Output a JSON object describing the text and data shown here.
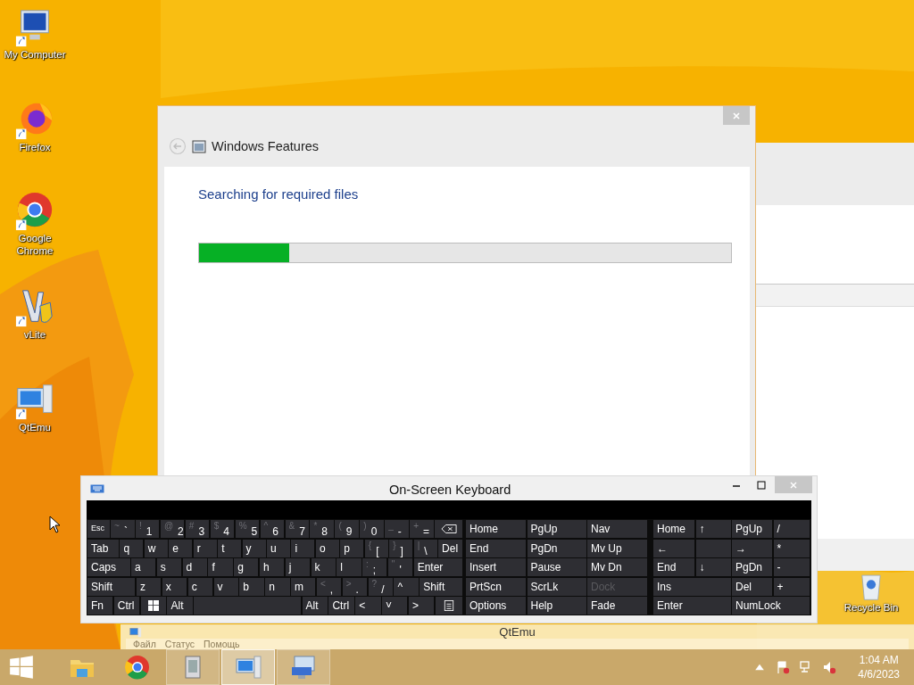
{
  "desktop_icons": [
    {
      "label": "My Computer",
      "kind": "computer"
    },
    {
      "label": "Firefox",
      "kind": "firefox"
    },
    {
      "label": "Google Chrome",
      "kind": "chrome"
    },
    {
      "label": "vLite",
      "kind": "vlite"
    },
    {
      "label": "QtEmu",
      "kind": "qtemu"
    }
  ],
  "recycle_bin": {
    "label": "Recycle Bin"
  },
  "features_window": {
    "title": "Windows Features",
    "status": "Searching for required files",
    "progress": {
      "level": 0.17
    }
  },
  "qtemu_window": {
    "title": "QtEmu",
    "menu": [
      "Файл",
      "Статус",
      "Помощь"
    ]
  },
  "keyboard": {
    "title": "On-Screen Keyboard",
    "main_rows": [
      [
        {
          "label": "Esc",
          "kind": "small"
        },
        {
          "label": "`",
          "shift": "~"
        },
        {
          "label": "1",
          "shift": "!"
        },
        {
          "label": "2",
          "shift": "@"
        },
        {
          "label": "3",
          "shift": "#"
        },
        {
          "label": "4",
          "shift": "$"
        },
        {
          "label": "5",
          "shift": "%"
        },
        {
          "label": "6",
          "shift": "^"
        },
        {
          "label": "7",
          "shift": "&"
        },
        {
          "label": "8",
          "shift": "*"
        },
        {
          "label": "9",
          "shift": "("
        },
        {
          "label": "0",
          "shift": ")"
        },
        {
          "label": "-",
          "shift": "_"
        },
        {
          "label": "=",
          "shift": "+"
        },
        {
          "kind": "backspace"
        }
      ],
      [
        {
          "label": "Tab"
        },
        {
          "label": "q"
        },
        {
          "label": "w"
        },
        {
          "label": "e"
        },
        {
          "label": "r"
        },
        {
          "label": "t"
        },
        {
          "label": "y"
        },
        {
          "label": "u"
        },
        {
          "label": "i"
        },
        {
          "label": "o"
        },
        {
          "label": "p"
        },
        {
          "label": "[",
          "shift": "{"
        },
        {
          "label": "]",
          "shift": "}"
        },
        {
          "label": "\\",
          "shift": "|"
        },
        {
          "label": "Del"
        }
      ],
      [
        {
          "label": "Caps"
        },
        {
          "label": "a"
        },
        {
          "label": "s"
        },
        {
          "label": "d"
        },
        {
          "label": "f"
        },
        {
          "label": "g"
        },
        {
          "label": "h"
        },
        {
          "label": "j"
        },
        {
          "label": "k"
        },
        {
          "label": "l"
        },
        {
          "label": ";",
          "shift": ":"
        },
        {
          "label": "'",
          "shift": "\""
        },
        {
          "label": "Enter"
        }
      ],
      [
        {
          "label": "Shift"
        },
        {
          "label": "z"
        },
        {
          "label": "x"
        },
        {
          "label": "c"
        },
        {
          "label": "v"
        },
        {
          "label": "b"
        },
        {
          "label": "n"
        },
        {
          "label": "m"
        },
        {
          "label": ",",
          "shift": "<"
        },
        {
          "label": ".",
          "shift": ">"
        },
        {
          "label": "/",
          "shift": "?"
        },
        {
          "label": "^"
        },
        {
          "label": "Shift"
        }
      ],
      [
        {
          "label": "Fn"
        },
        {
          "label": "Ctrl"
        },
        {
          "kind": "windows"
        },
        {
          "label": "Alt"
        },
        {
          "kind": "space"
        },
        {
          "label": "Alt"
        },
        {
          "label": "Ctrl"
        },
        {
          "label": "<"
        },
        {
          "label": "˅"
        },
        {
          "label": ">"
        },
        {
          "kind": "menu"
        }
      ]
    ],
    "nav_rows": [
      [
        {
          "label": "Home",
          "disabled": false
        },
        {
          "label": "PgUp",
          "disabled": false
        },
        {
          "label": "Nav",
          "disabled": false
        }
      ],
      [
        {
          "label": "End",
          "disabled": false
        },
        {
          "label": "PgDn",
          "disabled": false
        },
        {
          "label": "Mv Up",
          "disabled": false
        }
      ],
      [
        {
          "label": "Insert",
          "disabled": false
        },
        {
          "label": "Pause",
          "disabled": false
        },
        {
          "label": "Mv Dn",
          "disabled": false
        }
      ],
      [
        {
          "label": "PrtScn",
          "disabled": false
        },
        {
          "label": "ScrLk",
          "disabled": false
        },
        {
          "label": "Dock",
          "disabled": true
        }
      ],
      [
        {
          "label": "Options",
          "disabled": false
        },
        {
          "label": "Help",
          "disabled": false
        },
        {
          "label": "Fade",
          "disabled": false
        }
      ]
    ],
    "numpad_rows": [
      [
        {
          "label": "Home"
        },
        {
          "label": "↑"
        },
        {
          "label": "PgUp"
        },
        {
          "label": "/"
        }
      ],
      [
        {
          "label": "←"
        },
        {
          "kind": "blank"
        },
        {
          "label": "→"
        },
        {
          "label": "*"
        }
      ],
      [
        {
          "label": "End"
        },
        {
          "label": "↓"
        },
        {
          "label": "PgDn"
        },
        {
          "label": "-"
        }
      ],
      [
        {
          "label": "Ins",
          "kind": "wide"
        },
        {
          "label": "Del"
        },
        {
          "label": "+"
        }
      ],
      [
        {
          "label": "Enter",
          "kind": "wide"
        },
        {
          "label": "NumLock",
          "kind": "wide"
        }
      ]
    ]
  },
  "taskbar": {
    "items": [
      {
        "kind": "explorer",
        "running": false,
        "selected": false
      },
      {
        "kind": "chrome",
        "running": false,
        "selected": false
      },
      {
        "kind": "book",
        "running": true,
        "selected": false
      },
      {
        "kind": "qtemu",
        "running": true,
        "selected": true
      },
      {
        "kind": "keyboard",
        "running": true,
        "selected": false
      }
    ],
    "clock": {
      "time": "1:04 AM",
      "date": "4/6/2023"
    }
  }
}
